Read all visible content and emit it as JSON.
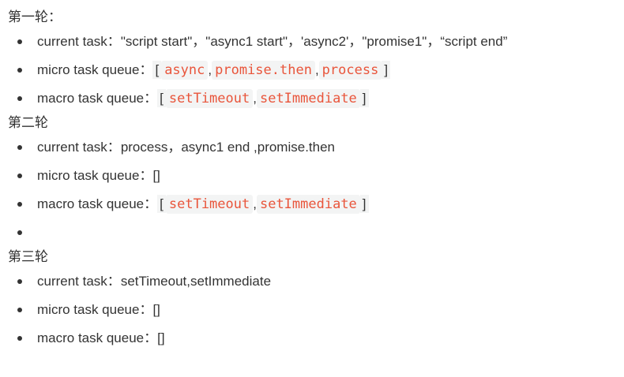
{
  "rounds": [
    {
      "heading": "第一轮：",
      "current_label": "current task：",
      "current_value": "\"script start\"，\"async1 start\"，'async2'，\"promise1\"，“script end”",
      "micro_label": "micro task queue：",
      "micro_open": "[",
      "micro_items": [
        "async",
        "promise.then",
        "process"
      ],
      "micro_close": "]",
      "macro_label": "macro task queue：",
      "macro_open": "[",
      "macro_items": [
        "setTimeout",
        "setImmediate"
      ],
      "macro_close": "]"
    },
    {
      "heading": "第二轮",
      "current_label": "current task：",
      "current_value": "process，async1 end ,promise.then",
      "micro_label": "micro task queue：",
      "micro_value": "[]",
      "macro_label": "macro task queue：",
      "macro_open": "[",
      "macro_items": [
        "setTimeout",
        "setImmediate"
      ],
      "macro_close": "]"
    },
    {
      "heading": "第三轮",
      "current_label": "current task：",
      "current_value": "setTimeout,setImmediate",
      "micro_label": "micro task queue：",
      "micro_value": "[]",
      "macro_label": "macro task queue：",
      "macro_value": "[]"
    }
  ],
  "separator": ","
}
